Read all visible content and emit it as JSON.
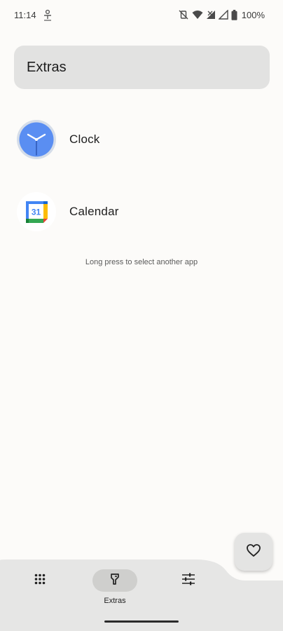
{
  "status_bar": {
    "time": "11:14",
    "battery": "100%"
  },
  "header": {
    "title": "Extras"
  },
  "apps": [
    {
      "label": "Clock",
      "icon": "clock-icon"
    },
    {
      "label": "Calendar",
      "icon": "calendar-icon",
      "day": "31"
    }
  ],
  "hint": "Long press to select another app",
  "fab": {
    "icon": "heart-icon"
  },
  "bottom_nav": {
    "items": [
      {
        "icon": "apps-grid-icon"
      },
      {
        "icon": "extras-icon",
        "label": "Extras",
        "active": true
      },
      {
        "icon": "settings-sliders-icon"
      }
    ]
  },
  "colors": {
    "background": "#fcfbf9",
    "header_card": "#e2e2e1",
    "clock_blue": "#5a8ef2",
    "nav_active": "#cfcfcd"
  }
}
